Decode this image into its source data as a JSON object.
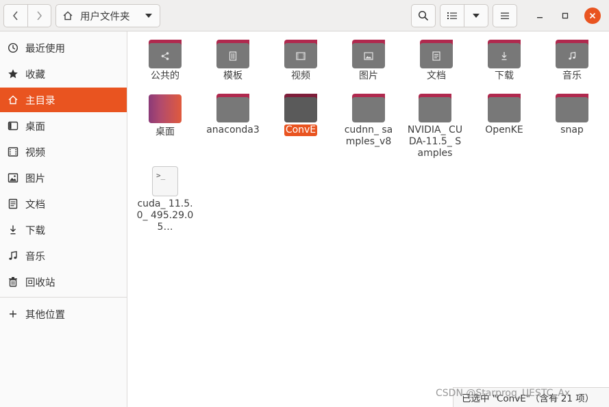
{
  "header": {
    "path_label": "用户文件夹"
  },
  "sidebar": {
    "items": [
      {
        "label": "最近使用",
        "icon": "clock-icon"
      },
      {
        "label": "收藏",
        "icon": "star-icon"
      },
      {
        "label": "主目录",
        "icon": "home-icon",
        "active": true
      },
      {
        "label": "桌面",
        "icon": "desktop-icon"
      },
      {
        "label": "视频",
        "icon": "video-icon"
      },
      {
        "label": "图片",
        "icon": "picture-icon"
      },
      {
        "label": "文档",
        "icon": "document-icon"
      },
      {
        "label": "下载",
        "icon": "download-icon"
      },
      {
        "label": "音乐",
        "icon": "music-icon"
      },
      {
        "label": "回收站",
        "icon": "trash-icon"
      }
    ],
    "other_locations": "其他位置"
  },
  "files": [
    {
      "name": "公共的",
      "kind": "folder",
      "glyph": "share-icon"
    },
    {
      "name": "模板",
      "kind": "folder",
      "glyph": "template-icon"
    },
    {
      "name": "视频",
      "kind": "folder",
      "glyph": "video-icon"
    },
    {
      "name": "图片",
      "kind": "folder",
      "glyph": "picture-icon"
    },
    {
      "name": "文档",
      "kind": "folder",
      "glyph": "document-icon"
    },
    {
      "name": "下载",
      "kind": "folder",
      "glyph": "download-icon"
    },
    {
      "name": "音乐",
      "kind": "folder",
      "glyph": "music-icon"
    },
    {
      "name": "桌面",
      "kind": "desktop-folder"
    },
    {
      "name": "anaconda3",
      "kind": "folder"
    },
    {
      "name": "ConvE",
      "kind": "folder",
      "selected": true
    },
    {
      "name": "cudnn_ samples_v8",
      "kind": "folder"
    },
    {
      "name": "NVIDIA_ CUDA-11.5_ Samples",
      "kind": "folder"
    },
    {
      "name": "OpenKE",
      "kind": "folder"
    },
    {
      "name": "snap",
      "kind": "folder"
    },
    {
      "name": "cuda_ 11.5.0_ 495.29.05…",
      "kind": "script",
      "glyph_text": ">_"
    }
  ],
  "status": "已选中 \"ConvE\"（含有 21 项）",
  "watermark": "CSDN @Starprog_UESTC_Ax",
  "colors": {
    "accent": "#e95420",
    "folder_body": "#787878",
    "folder_tab": "#b0294e"
  }
}
